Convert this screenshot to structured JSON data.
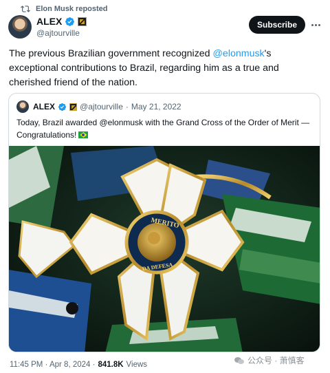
{
  "repost": {
    "icon": "repost-icon",
    "text": "Elon Musk reposted"
  },
  "post": {
    "author_name": "ALEX",
    "author_handle": "@ajtourville",
    "verified_icon": "verified-badge-icon",
    "affiliate_icon": "affiliate-badge-icon",
    "subscribe_label": "Subscribe",
    "more_icon": "more-dots-icon",
    "text_before": "The previous Brazilian government recognized ",
    "mention": "@elonmusk",
    "text_after": "'s exceptional contributions to Brazil, regarding him as a true and cherished friend of the nation.",
    "timestamp": "11:45 PM · Apr 8, 2024 · ",
    "views_count": "841.8K",
    "views_label": " Views"
  },
  "quote": {
    "author_name": "ALEX",
    "author_handle": "@ajtourville",
    "separator": "·",
    "date": "May 21, 2022",
    "text": "Today, Brazil awarded @elonmusk with the Grand Cross of the Order of Merit — Congratulations!",
    "flag_icon": "brazil-flag-icon",
    "medal_text_top": "MERITO",
    "medal_text_bottom": "DA DEFESA"
  },
  "watermark": {
    "icon": "wechat-channel-icon",
    "text": "公众号 · 萧慎客"
  },
  "colors": {
    "accent": "#1d9bf0",
    "text": "#0f1419",
    "muted": "#536471",
    "border": "#cfd9de"
  }
}
